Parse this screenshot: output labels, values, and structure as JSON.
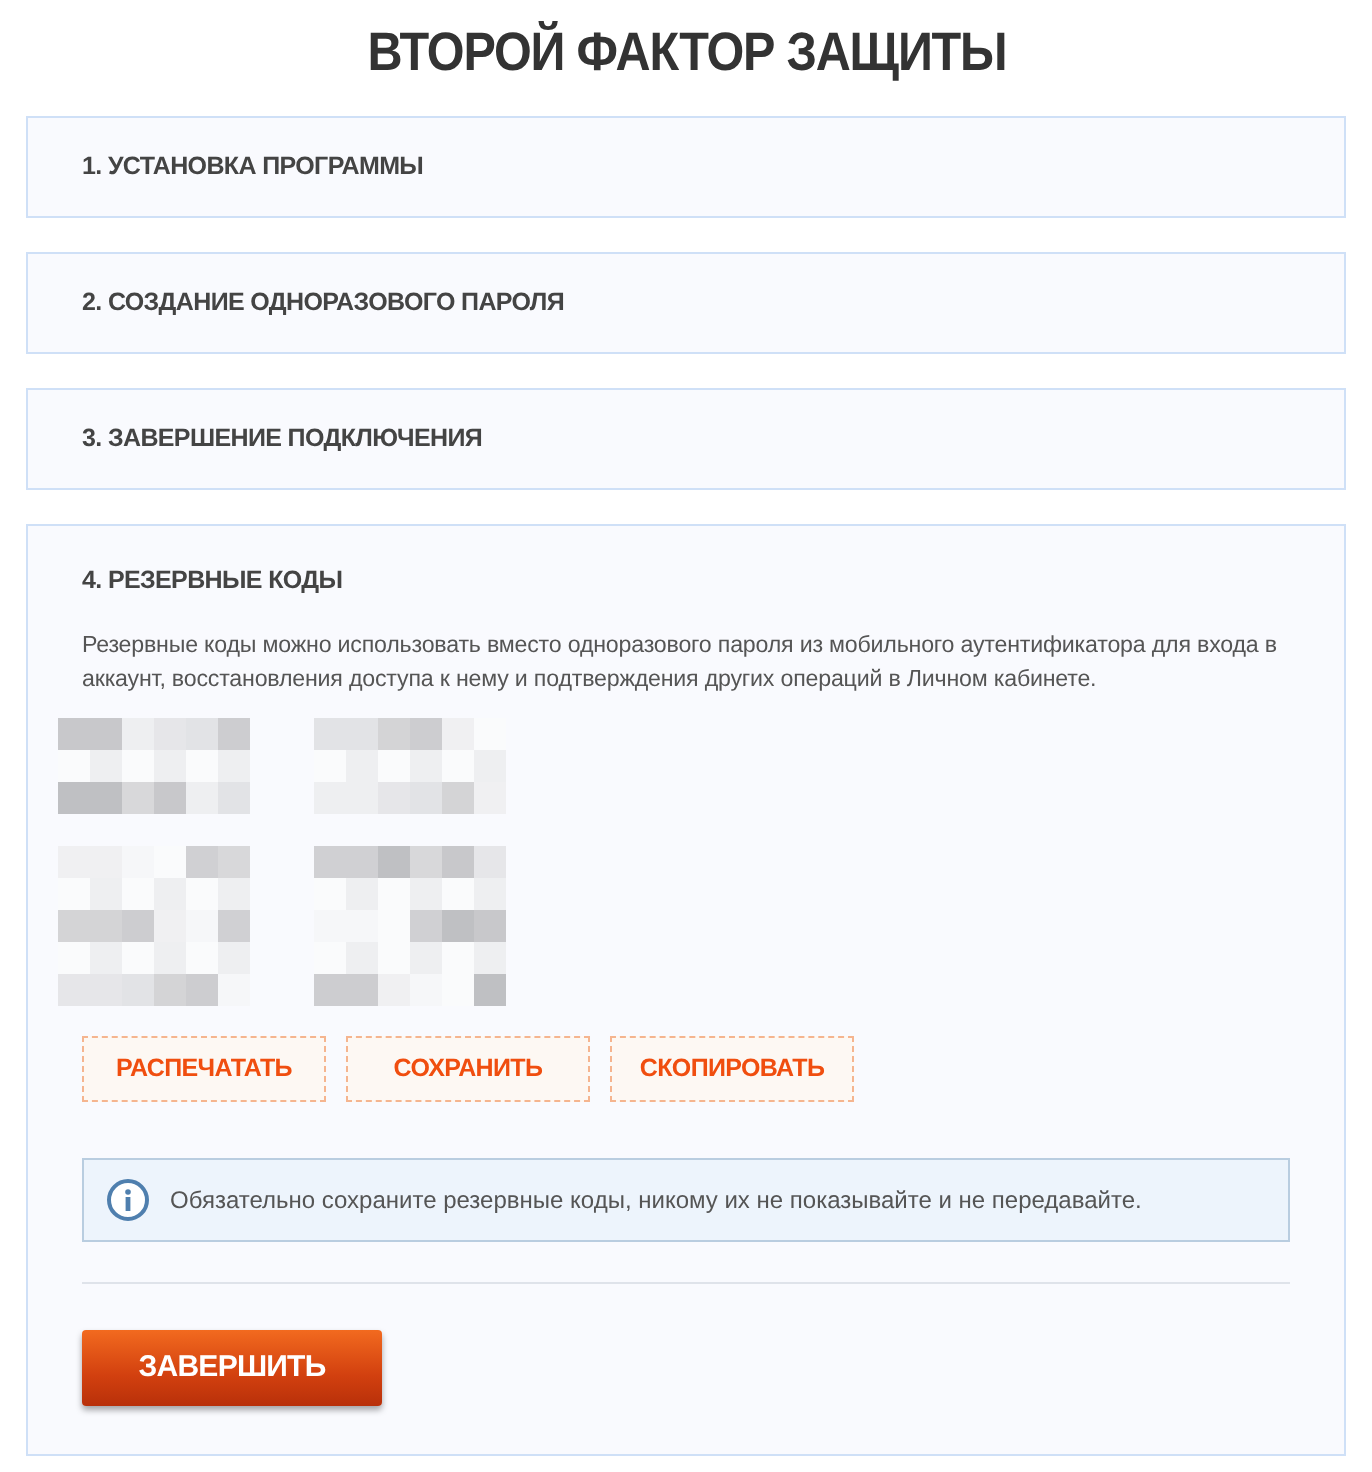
{
  "title": "ВТОРОЙ ФАКТОР ЗАЩИТЫ",
  "steps": [
    {
      "title": "1. УСТАНОВКА ПРОГРАММЫ",
      "expanded": false
    },
    {
      "title": "2. СОЗДАНИЕ ОДНОРАЗОВОГО ПАРОЛЯ",
      "expanded": false
    },
    {
      "title": "3. ЗАВЕРШЕНИЕ ПОДКЛЮЧЕНИЯ",
      "expanded": false
    },
    {
      "title": "4. РЕЗЕРВНЫЕ КОДЫ",
      "expanded": true,
      "description": "Резервные коды можно использовать вместо одноразового пароля из мобильного аутентификатора для входа в аккаунт, восстановления доступа к нему и подтверждения других операций в Личном кабинете.",
      "codes": [
        {
          "kind": "pixelated"
        },
        {
          "kind": "pixelated"
        },
        {
          "kind": "pixelated"
        },
        {
          "kind": "pixelated"
        }
      ],
      "actions": [
        "РАСПЕЧАТАТЬ",
        "СОХРАНИТЬ",
        "СКОПИРОВАТЬ"
      ],
      "notice": "Обязательно сохраните резервные коды, никому их не показывайте и не передавайте.",
      "finish_button": "ЗАВЕРШИТЬ"
    }
  ]
}
